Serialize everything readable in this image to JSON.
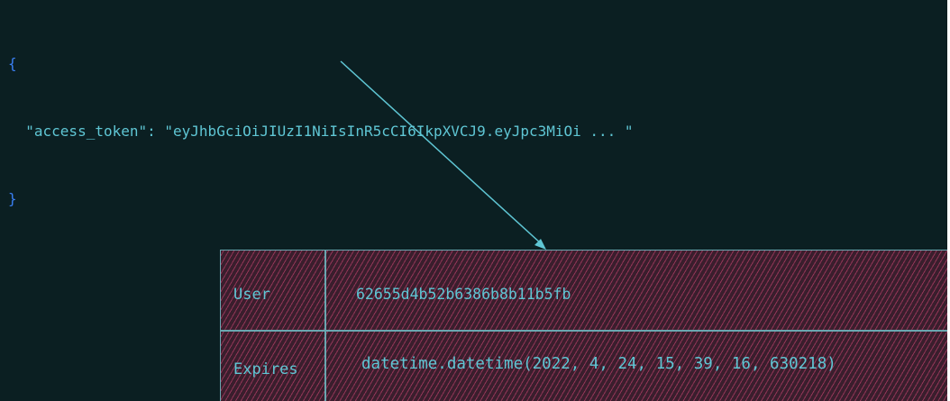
{
  "json_snippet": {
    "open_brace": "{",
    "key": "\"access_token\"",
    "separator": ": ",
    "value": "\"eyJhbGciOiJIUzI1NiIsInR5cCI6IkpXVCJ9.eyJpc3MiOi ... \"",
    "close_brace": "}"
  },
  "decoded_table": {
    "rows": [
      {
        "label": "User",
        "value": "62655d4b52b6386b8b11b5fb"
      },
      {
        "label": "Expires",
        "value": "datetime.datetime(2022, 4, 24, 15, 39, 16, 630218)"
      }
    ]
  },
  "colors": {
    "background": "#0b1f22",
    "brace": "#3a7ff2",
    "text": "#5fc6d4",
    "table_fill": "#3a1e2d",
    "hatch": "#d64878",
    "border": "#6aa6b0"
  }
}
